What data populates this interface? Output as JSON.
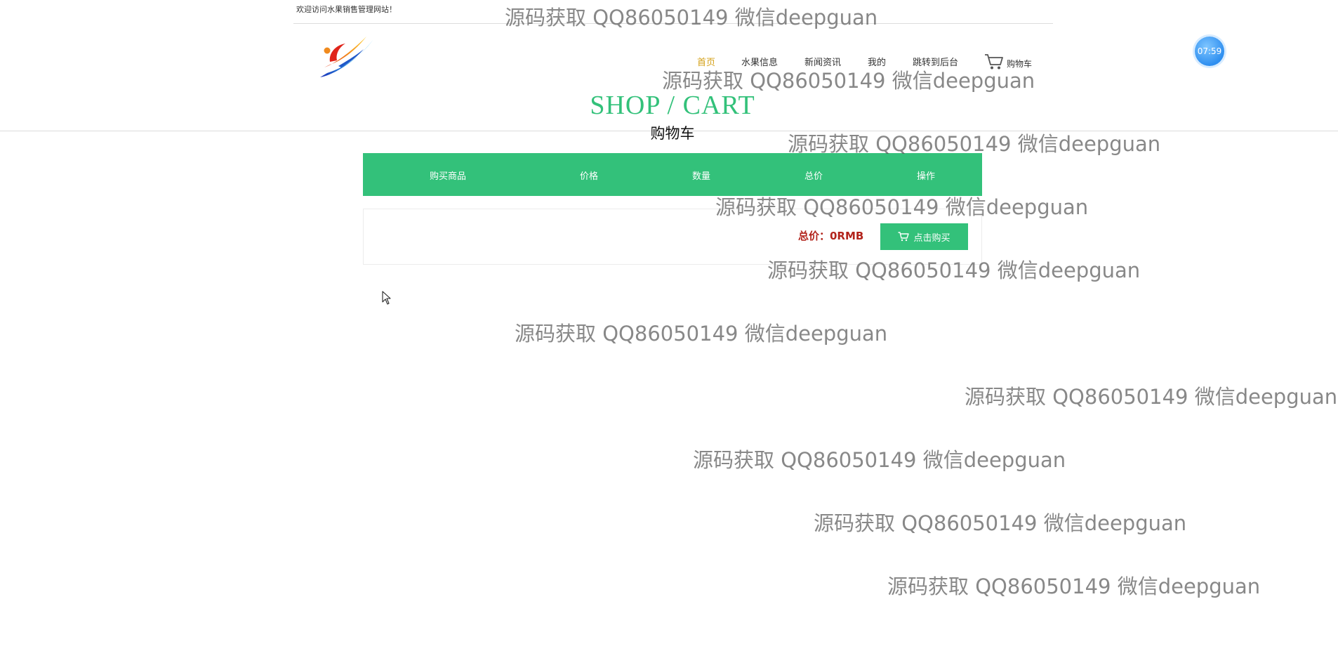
{
  "header": {
    "welcome_text": "欢迎访问水果销售管理网站！",
    "nav": [
      {
        "label": "首页",
        "active": true
      },
      {
        "label": "水果信息",
        "active": false
      },
      {
        "label": "新闻资讯",
        "active": false
      },
      {
        "label": "我的",
        "active": false
      },
      {
        "label": "跳转到后台",
        "active": false
      }
    ],
    "cart_label": "购物车",
    "clock": "07:59"
  },
  "page": {
    "title_en": "SHOP / CART",
    "title_cn": "购物车"
  },
  "cart_table": {
    "columns": [
      "购买商品",
      "价格",
      "数量",
      "总价",
      "操作"
    ],
    "rows": []
  },
  "summary": {
    "total_text": "总价：0RMB",
    "buy_label": "点击购买"
  },
  "watermark_text": "源码获取 QQ86050149 微信deepguan",
  "colors": {
    "accent_green": "#33c17a",
    "nav_active": "#d4a017",
    "total_red": "#b2241c",
    "clock_blue": "#2f8ff0"
  }
}
